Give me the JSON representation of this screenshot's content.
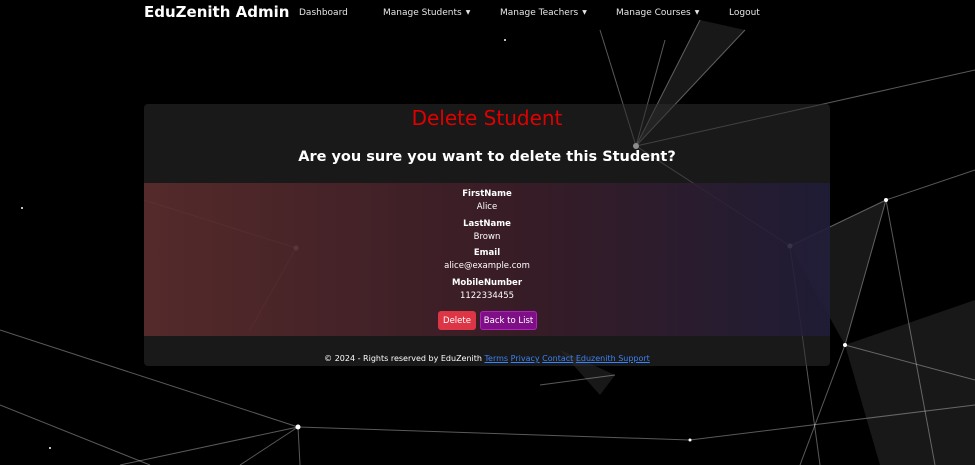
{
  "navbar": {
    "brand": "EduZenith Admin",
    "items": [
      {
        "label": "Dashboard",
        "dropdown": false
      },
      {
        "label": "Manage Students",
        "dropdown": true
      },
      {
        "label": "Manage Teachers",
        "dropdown": true
      },
      {
        "label": "Manage Courses",
        "dropdown": true
      },
      {
        "label": "Logout",
        "dropdown": false
      }
    ],
    "caret": "▼"
  },
  "page": {
    "title": "Delete Student",
    "question": "Are you sure you want to delete this Student?",
    "title_color": "#e00000"
  },
  "student": {
    "fields": [
      {
        "label": "FirstName",
        "value": "Alice"
      },
      {
        "label": "LastName",
        "value": "Brown"
      },
      {
        "label": "Email",
        "value": "alice@example.com"
      },
      {
        "label": "MobileNumber",
        "value": "1122334455"
      }
    ]
  },
  "actions": {
    "delete_label": "Delete",
    "back_label": "Back to List",
    "delete_color": "#dc3545",
    "back_color": "#7e0f86"
  },
  "footer": {
    "text": "© 2024 - Rights reserved by EduZenith",
    "links": [
      "Terms",
      "Privacy",
      "Contact",
      "Eduzenith Support"
    ]
  }
}
